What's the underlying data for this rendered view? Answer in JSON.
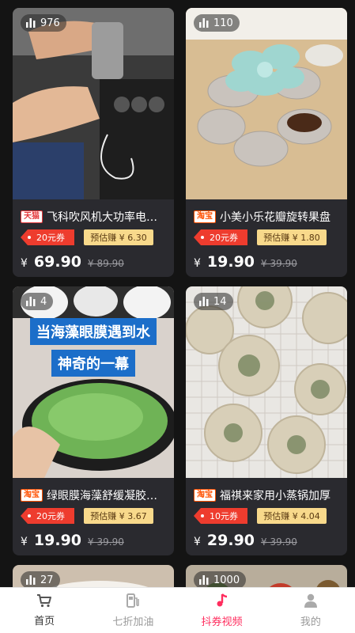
{
  "products": [
    {
      "views": "976",
      "platform": "天猫",
      "title": "飞科吹风机大功率电吹风机",
      "coupon": "20元券",
      "earn": "预估赚 ¥ 6.30",
      "yen": "¥",
      "price": "69.90",
      "original": "¥ 89.90"
    },
    {
      "views": "110",
      "platform": "淘宝",
      "title": "小美小乐花瓣旋转果盘",
      "coupon": "20元券",
      "earn": "预估赚 ¥ 1.80",
      "yen": "¥",
      "price": "19.90",
      "original": "¥ 39.90"
    },
    {
      "views": "4",
      "platform": "淘宝",
      "title": "绿眼膜海藻舒缓凝胶眼贴",
      "coupon": "20元券",
      "earn": "预估赚 ¥ 3.67",
      "yen": "¥",
      "price": "19.90",
      "original": "¥ 39.90"
    },
    {
      "views": "14",
      "platform": "淘宝",
      "title": "福祺来家用小蒸锅加厚",
      "coupon": "10元券",
      "earn": "预估赚 ¥ 4.04",
      "yen": "¥",
      "price": "29.90",
      "original": "¥ 39.90"
    },
    {
      "views": "27"
    },
    {
      "views": "1000"
    }
  ],
  "thumb_text": {
    "mask_line1": "当海藻眼膜遇到水",
    "mask_line2": "神奇的一幕"
  },
  "tabbar": {
    "home": "首页",
    "fuel": "七折加油",
    "video": "抖券视频",
    "mine": "我的"
  },
  "colors": {
    "accent": "#ff2d5e",
    "coupon": "#ee3c2e",
    "earn_bg": "#f8d98b",
    "card_bg": "#2a2a2f"
  }
}
